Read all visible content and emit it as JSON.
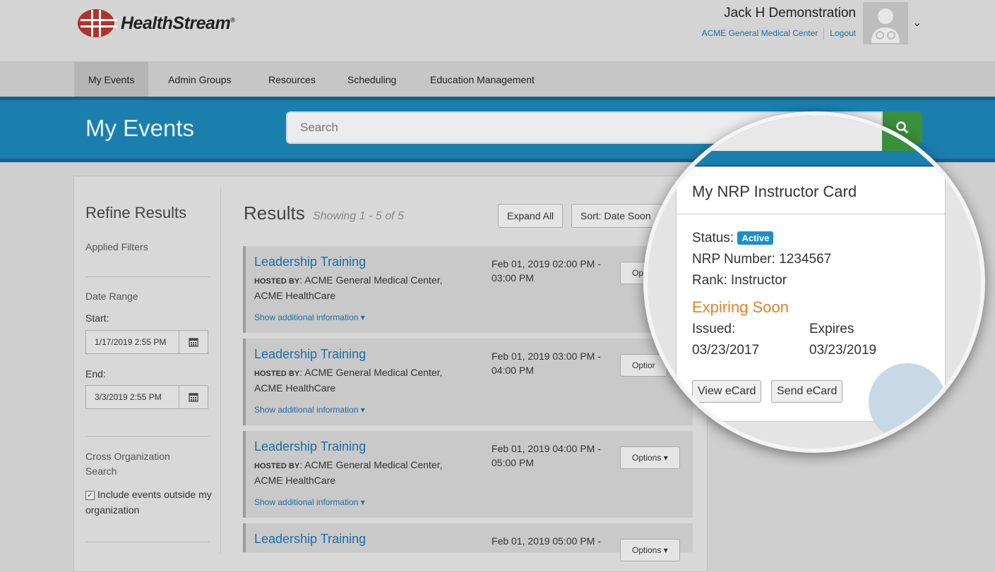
{
  "header": {
    "brand": "HealthStream",
    "brand_mark": "®",
    "user_name": "Jack H Demonstration",
    "org_link": "ACME General Medical Center",
    "logout_link": "Logout"
  },
  "nav": {
    "items": [
      "My Events",
      "Admin Groups",
      "Resources",
      "Scheduling",
      "Education Management"
    ],
    "active": "My Events"
  },
  "band": {
    "title": "My Events",
    "search_placeholder": "Search"
  },
  "sidebar": {
    "title": "Refine Results",
    "applied_filters": "Applied Filters",
    "date_range_label": "Date Range",
    "start_label": "Start:",
    "start_value": "1/17/2019 2:55 PM",
    "end_label": "End:",
    "end_value": "3/3/2019 2:55 PM",
    "cross_org_label": "Cross Organization Search",
    "checkbox_label": "Include events outside my organization",
    "checkbox_checked": true
  },
  "results": {
    "title": "Results",
    "showing": "Showing 1 - 5 of 5",
    "expand_all": "Expand All",
    "sort_label": "Sort: Date Soon",
    "events": [
      {
        "title": "Leadership Training",
        "host_label": "HOSTED BY",
        "host": ": ACME General Medical Center, ACME HealthCare",
        "time": "Feb 01, 2019 02:00 PM - 03:00 PM",
        "more": "Show additional information ▾",
        "options": "Op"
      },
      {
        "title": "Leadership Training",
        "host_label": "HOSTED BY",
        "host": ": ACME General Medical Center, ACME HealthCare",
        "time": "Feb 01, 2019 03:00 PM - 04:00 PM",
        "more": "Show additional information ▾",
        "options": "Optior"
      },
      {
        "title": "Leadership Training",
        "host_label": "HOSTED BY",
        "host": ": ACME General Medical Center, ACME HealthCare",
        "time": "Feb 01, 2019 04:00 PM - 05:00 PM",
        "more": "Show additional information ▾",
        "options": "Options ▾"
      },
      {
        "title": "Leadership Training",
        "host_label": "HOSTED BY",
        "host": "",
        "time": "Feb 01, 2019 05:00 PM -",
        "more": "",
        "options": "Options ▾"
      }
    ]
  },
  "card": {
    "title": "My NRP Instructor Card",
    "status_label": "Status:",
    "status_badge": "Active",
    "nrp_number": "NRP Number: 1234567",
    "rank": "Rank: Instructor",
    "expiring": "Expiring Soon",
    "issued_label": "Issued:",
    "issued_value": "03/23/2017",
    "expires_label": "Expires",
    "expires_value": "03/23/2019",
    "view_button": "View eCard",
    "send_button": "Send eCard"
  },
  "colors": {
    "brand_blue": "#1b7fae",
    "link_blue": "#1a6fa5",
    "search_green": "#3a8f3a",
    "expiring_orange": "#e8802a",
    "badge_blue": "#1a8fcc"
  }
}
